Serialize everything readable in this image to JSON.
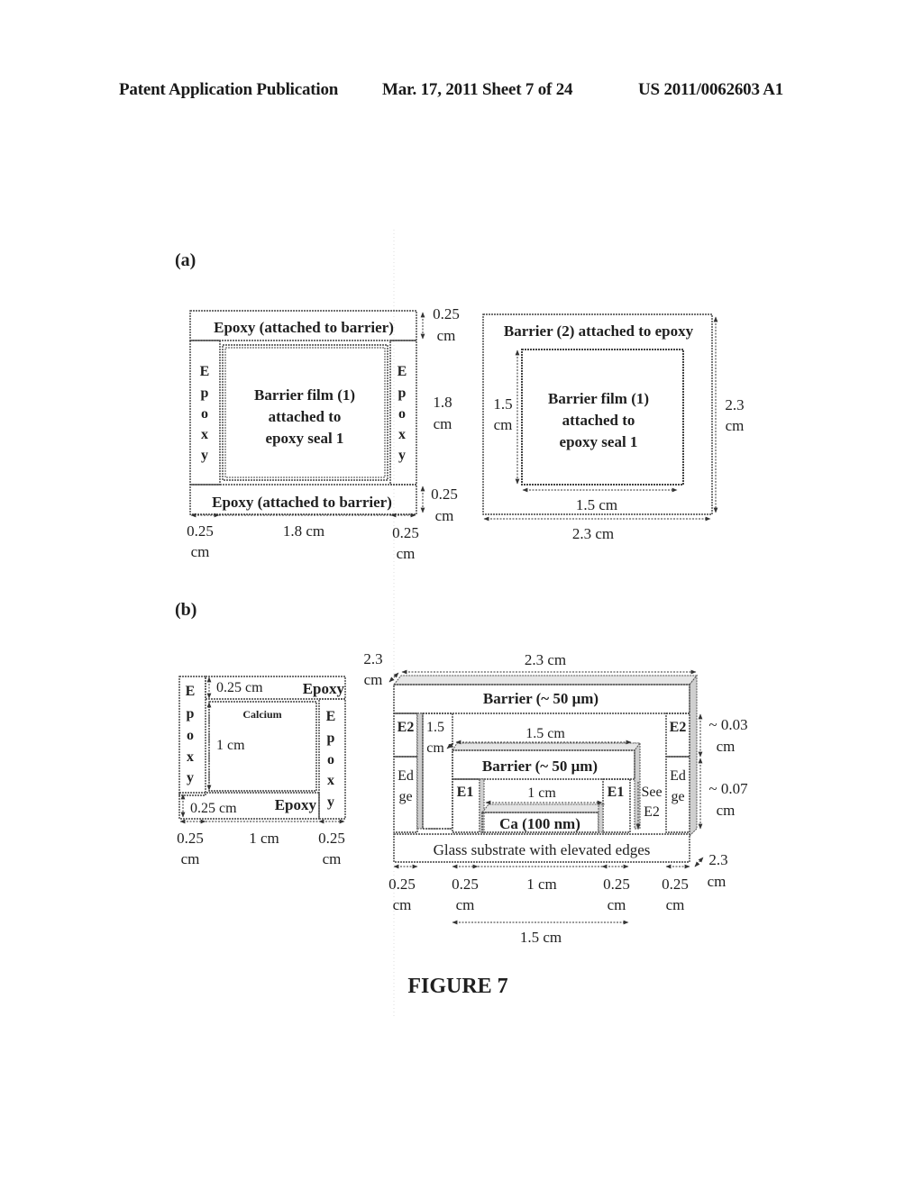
{
  "header": {
    "publication": "Patent Application Publication",
    "date_sheet": "Mar. 17, 2011  Sheet 7 of 24",
    "number": "US 2011/0062603 A1"
  },
  "panel_a": {
    "label": "(a)",
    "left": {
      "epoxy_top": "Epoxy (attached to barrier)",
      "epoxy_bottom": "Epoxy (attached to barrier)",
      "epoxy_side_letters": [
        "E",
        "p",
        "o",
        "x",
        "y"
      ],
      "center": [
        "Barrier film (1)",
        "attached to",
        "epoxy seal 1"
      ],
      "dim_top_right": [
        "0.25",
        "cm"
      ],
      "dim_middle_right": [
        "1.8",
        "cm"
      ],
      "dim_bottom_right": [
        "0.25",
        "cm"
      ],
      "dim_bottom_left": [
        "0.25",
        "cm"
      ],
      "dim_bottom_center": "1.8 cm",
      "dim_bottom_rightcol": [
        "0.25",
        "cm"
      ]
    },
    "right": {
      "outer_label": "Barrier (2) attached to epoxy",
      "center": [
        "Barrier film (1)",
        "attached to",
        "epoxy seal 1"
      ],
      "dim_inner_height": [
        "1.5",
        "cm"
      ],
      "dim_inner_width": "1.5 cm",
      "dim_outer_height": [
        "2.3",
        "cm"
      ],
      "dim_outer_width": "2.3 cm"
    }
  },
  "panel_b": {
    "label": "(b)",
    "left": {
      "epoxy_top": "Epoxy",
      "epoxy_bottom": "Epoxy",
      "dim_top": "0.25 cm",
      "dim_bottom": "0.25 cm",
      "center_label": "Calcium",
      "center_dim": "1 cm",
      "epoxy_side_letters": [
        "E",
        "p",
        "o",
        "x",
        "y"
      ],
      "dim_bottom_left": [
        "0.25",
        "cm"
      ],
      "dim_bottom_center": "1 cm",
      "dim_bottom_right": [
        "0.25",
        "cm"
      ]
    },
    "right": {
      "dim_depth_top": [
        "2.3",
        "cm"
      ],
      "dim_width_top": "2.3 cm",
      "outer_barrier": "Barrier (~ 50 μm)",
      "inner_barrier": "Barrier (~ 50 μm)",
      "e2": "E2",
      "e1": "E1",
      "edge": [
        "Ed",
        "ge"
      ],
      "dim_inner_depth": [
        "1.5",
        "cm"
      ],
      "dim_inner_width": "1.5 cm",
      "dim_ca_width": "1 cm",
      "ca": "Ca (100 nm)",
      "see_e2": [
        "See",
        "E2"
      ],
      "glass": "Glass substrate with elevated edges",
      "dim_right_top": [
        "~ 0.03",
        "cm"
      ],
      "dim_right_mid": [
        "~ 0.07",
        "cm"
      ],
      "dim_right_bottom": [
        "2.3",
        "cm"
      ],
      "dim_bottom_labels": [
        [
          "0.25",
          "cm"
        ],
        [
          "0.25",
          "cm"
        ],
        [
          "1 cm"
        ],
        [
          "0.25",
          "cm"
        ],
        [
          "0.25",
          "cm"
        ]
      ],
      "dim_bottom_span": "1.5 cm"
    }
  },
  "figure_caption": "FIGURE 7"
}
